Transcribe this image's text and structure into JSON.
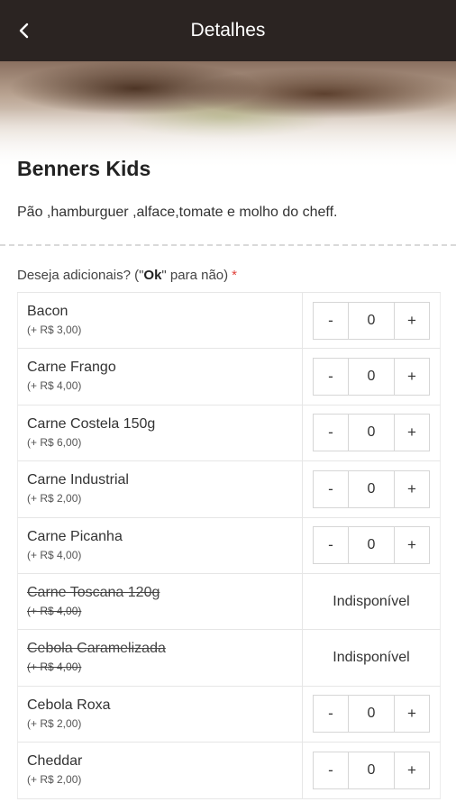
{
  "header": {
    "title": "Detalhes",
    "back_icon": "chevron-left-icon"
  },
  "product": {
    "name": "Benners Kids",
    "description": "Pão ,hamburguer ,alface,tomate e molho do cheff."
  },
  "addons": {
    "question_prefix": "Deseja adicionais? (\"",
    "question_bold": "Ok",
    "question_suffix": "\" para não)",
    "required_mark": "*",
    "minus_label": "-",
    "plus_label": "+",
    "unavailable_label": "Indisponível",
    "items": [
      {
        "name": "Bacon",
        "price": "(+ R$ 3,00)",
        "quantity": "0",
        "available": true
      },
      {
        "name": "Carne Frango",
        "price": "(+ R$ 4,00)",
        "quantity": "0",
        "available": true
      },
      {
        "name": "Carne Costela 150g",
        "price": "(+ R$ 6,00)",
        "quantity": "0",
        "available": true
      },
      {
        "name": "Carne Industrial",
        "price": "(+ R$ 2,00)",
        "quantity": "0",
        "available": true
      },
      {
        "name": "Carne Picanha",
        "price": "(+ R$ 4,00)",
        "quantity": "0",
        "available": true
      },
      {
        "name": "Carne Toscana 120g",
        "price": "(+ R$ 4,00)",
        "quantity": "",
        "available": false
      },
      {
        "name": "Cebola Caramelizada",
        "price": "(+ R$ 4,00)",
        "quantity": "",
        "available": false
      },
      {
        "name": "Cebola Roxa",
        "price": "(+ R$ 2,00)",
        "quantity": "0",
        "available": true
      },
      {
        "name": "Cheddar",
        "price": "(+ R$ 2,00)",
        "quantity": "0",
        "available": true
      }
    ]
  },
  "colors": {
    "topbar": "#2b2422",
    "required": "#e0413a"
  }
}
